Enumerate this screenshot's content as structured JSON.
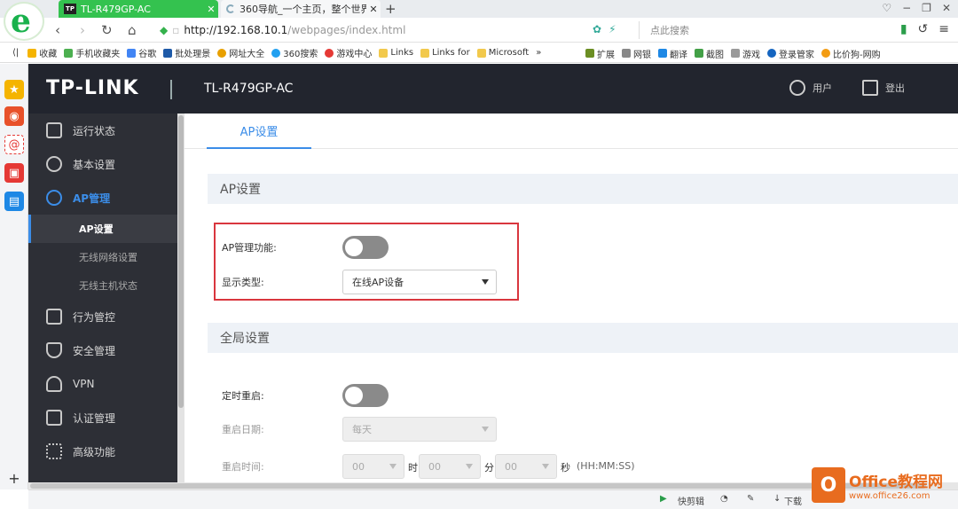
{
  "browser": {
    "tabs": [
      {
        "favicon": "TP",
        "title": "TL-R479GP-AC",
        "active": true
      },
      {
        "title": "360导航_一个主页，整个世界",
        "active": false
      }
    ],
    "new_tab": "+",
    "address": {
      "host": "http://192.168.10.1",
      "path": "/webpages/index.html"
    },
    "search_placeholder": "点此搜索",
    "bookmarks_left": [
      "收藏",
      "手机收藏夹",
      "谷歌",
      "批处理景",
      "网址大全",
      "360搜索",
      "游戏中心",
      "Links",
      "Links for",
      "Microsoft"
    ],
    "bookmarks_more": "»",
    "bookmarks_right": [
      "扩展",
      "网银",
      "翻译",
      "截图",
      "游戏",
      "登录管家",
      "比价狗-网购"
    ],
    "status_bar": [
      "快剪辑",
      "下载"
    ]
  },
  "app": {
    "model": "TL-R479GP-AC",
    "logo": "TP-LINK",
    "header_user": "用户",
    "header_logout": "登出"
  },
  "menu": {
    "items": [
      {
        "label": "运行状态",
        "icon": "monitor-icon"
      },
      {
        "label": "基本设置",
        "icon": "gear-icon"
      },
      {
        "label": "AP管理",
        "icon": "ap-signal-icon",
        "active": true
      },
      {
        "label": "行为管控",
        "icon": "behavior-icon"
      },
      {
        "label": "安全管理",
        "icon": "shield-icon"
      },
      {
        "label": "VPN",
        "icon": "vpn-cloud-icon"
      },
      {
        "label": "认证管理",
        "icon": "auth-icon"
      },
      {
        "label": "高级功能",
        "icon": "grid-icon"
      }
    ],
    "sub_items": [
      "AP设置",
      "无线网络设置",
      "无线主机状态"
    ]
  },
  "content": {
    "tab": "AP设置",
    "section1": "AP设置",
    "ap_manage_label": "AP管理功能:",
    "ap_manage_on": false,
    "display_type_label": "显示类型:",
    "display_type_value": "在线AP设备",
    "section2": "全局设置",
    "timed_reboot_label": "定时重启:",
    "timed_reboot_on": false,
    "reboot_date_label": "重启日期:",
    "reboot_date_value": "每天",
    "reboot_time_label": "重启时间:",
    "hour_value": "00",
    "minute_value": "00",
    "second_value": "00",
    "hour_unit": "时",
    "minute_unit": "分",
    "second_unit": "秒",
    "time_format": "(HH:MM:SS)"
  },
  "watermark": {
    "title": "Office教程网",
    "url": "www.office26.com"
  },
  "colors": {
    "accent": "#3b8de8",
    "header_bg": "#22252e",
    "menu_bg": "#2d2f36",
    "highlight": "#d9363e",
    "browser_green": "#34c24f"
  }
}
